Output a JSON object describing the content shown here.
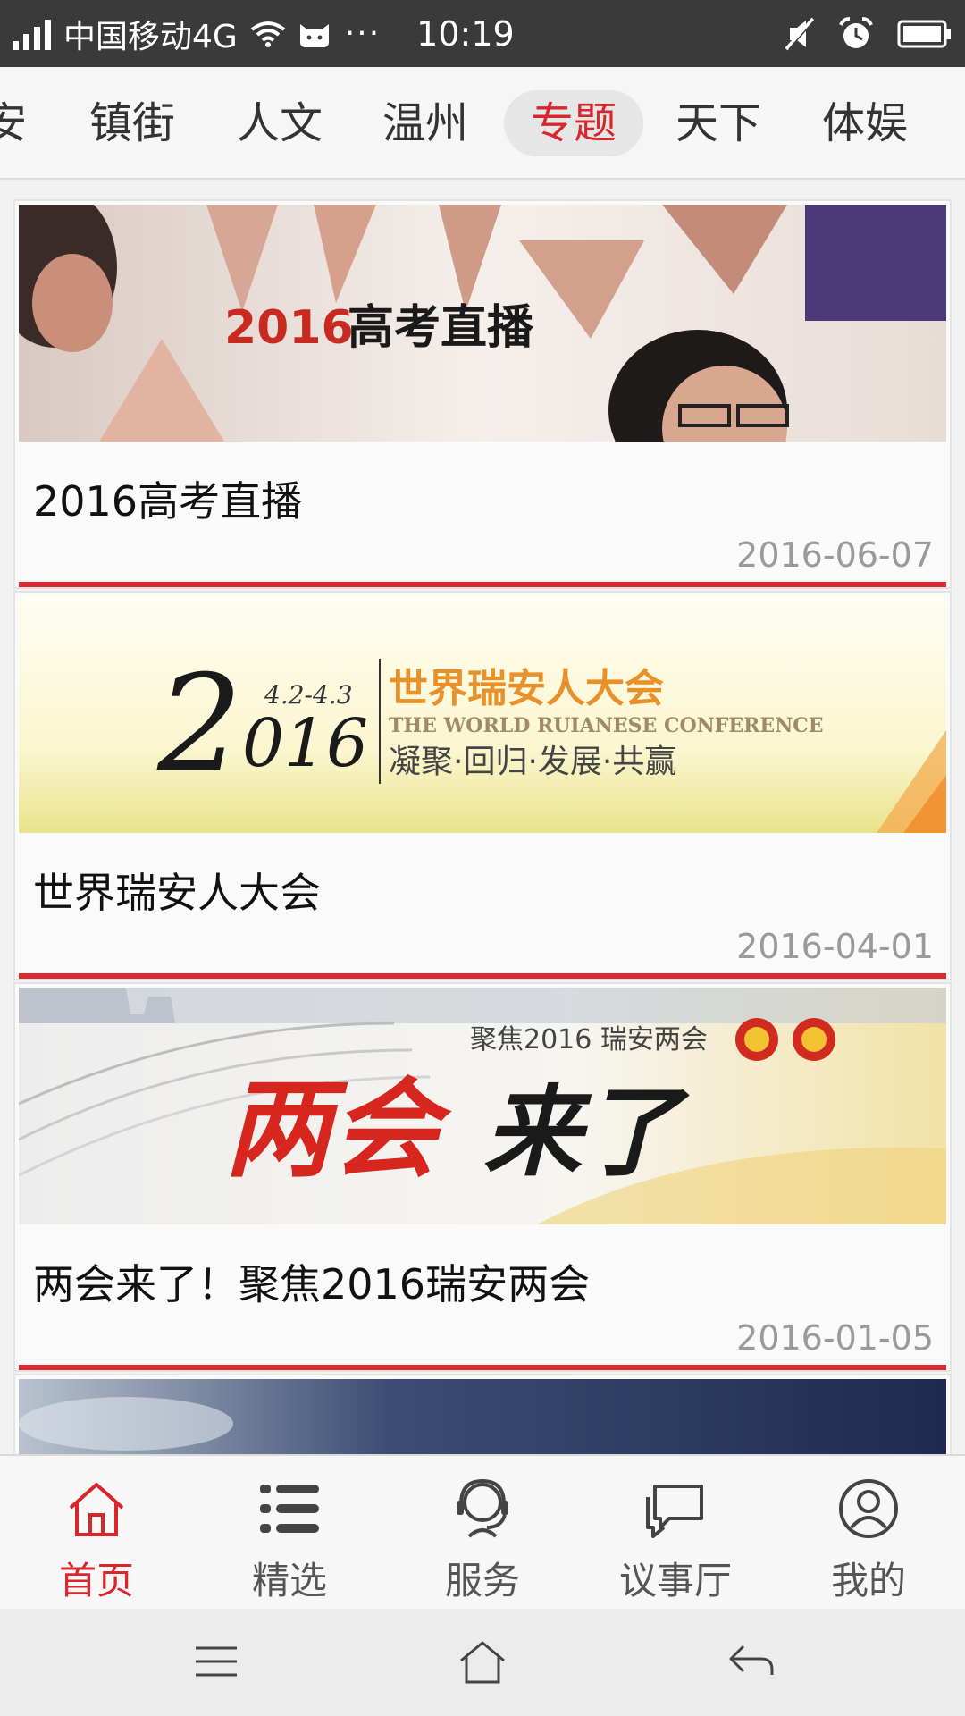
{
  "status_bar": {
    "carrier": "中国移动4G",
    "dots": "···",
    "time": "10:19",
    "icons": [
      "signal-icon",
      "wifi-icon",
      "notification-cat-icon",
      "mute-icon",
      "alarm-icon",
      "battery-icon"
    ]
  },
  "tabs": [
    {
      "label": "安",
      "active": false
    },
    {
      "label": "镇街",
      "active": false
    },
    {
      "label": "人文",
      "active": false
    },
    {
      "label": "温州",
      "active": false
    },
    {
      "label": "专题",
      "active": true
    },
    {
      "label": "天下",
      "active": false
    },
    {
      "label": "体娱",
      "active": false
    }
  ],
  "cards": [
    {
      "banner_text": "2016高考直播",
      "title": "2016高考直播",
      "date": "2016-06-07"
    },
    {
      "banner_text": {
        "year_big": "2",
        "year_small": "016",
        "dates": "4.2-4.3",
        "cn_title": "世界瑞安人大会",
        "en_title": "THE WORLD RUIANESE CONFERENCE",
        "slogan": "凝聚·回归·发展·共赢"
      },
      "title": "世界瑞安人大会",
      "date": "2016-04-01"
    },
    {
      "banner_text": {
        "focus": "聚焦2016 瑞安两会",
        "main_red": "两会",
        "main_black": "来了"
      },
      "title": "两会来了！聚焦2016瑞安两会",
      "date": "2016-01-05"
    }
  ],
  "bottom_nav": [
    {
      "label": "首页",
      "icon": "home-icon",
      "active": true
    },
    {
      "label": "精选",
      "icon": "list-icon",
      "active": false
    },
    {
      "label": "服务",
      "icon": "service-icon",
      "active": false
    },
    {
      "label": "议事厅",
      "icon": "chat-icon",
      "active": false
    },
    {
      "label": "我的",
      "icon": "profile-icon",
      "active": false
    }
  ],
  "colors": {
    "accent": "#d9262d",
    "status_bar": "#3a3a3a",
    "date_text": "#9a9a9a"
  }
}
